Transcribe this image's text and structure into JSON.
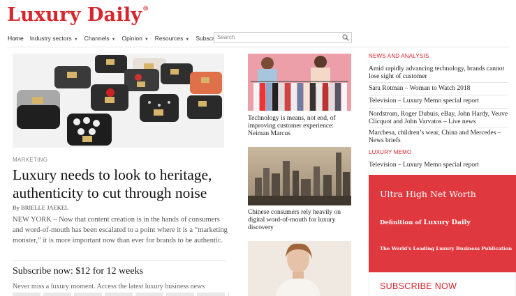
{
  "brand": {
    "name": "Luxury Daily",
    "reg": "®",
    "color": "#d6262e"
  },
  "nav": {
    "items": [
      {
        "label": "Home",
        "dropdown": false
      },
      {
        "label": "Industry sectors",
        "dropdown": true
      },
      {
        "label": "Channels",
        "dropdown": true
      },
      {
        "label": "Opinion",
        "dropdown": true
      },
      {
        "label": "Resources",
        "dropdown": true
      },
      {
        "label": "Subscribe",
        "dropdown": false
      }
    ],
    "search_placeholder": "Search"
  },
  "lead": {
    "kicker": "MARKETING",
    "headline": "Luxury needs to look to heritage, authenticity to cut through noise",
    "byline": "By BRIELLE JAEKEL",
    "teaser": "NEW YORK – Now that content creation is in the hands of consumers and word-of-mouth has been escalated to a point where it is a “marketing monster,” it is more important now than ever for brands to be authentic."
  },
  "subscribe": {
    "offer": "Subscribe now: $12 for 12 weeks",
    "desc": "Never miss a luxury moment. Access the latest luxury business news"
  },
  "middle": {
    "stories": [
      {
        "caption": "Technology is means, not end, of improving customer experience: Neiman Marcus"
      },
      {
        "caption": "Chinese consumers rely heavily on digital word-of-mouth for luxury discovery"
      }
    ]
  },
  "news": {
    "section_label": "NEWS AND ANALYSIS",
    "items": [
      "Amid rapidly advancing technology, brands cannot lose sight of customer",
      "Sara Rotman – Woman to Watch 2018",
      "Television – Luxury Memo special report",
      "Nordstrom, Roger Dubuis, eBay, John Hardy, Veuve Clicquot and John Varvatos – Live news",
      "Marchesa, children’s wear, China and Mercedes – News briefs"
    ]
  },
  "memo": {
    "section_label": "LUXURY MEMO",
    "items": [
      "Television – Luxury Memo special report"
    ]
  },
  "ad": {
    "title": "Ultra High Net Worth",
    "definition_prefix": "Definition of ",
    "definition_brand": "Luxury Daily",
    "tagline": "The World's Leading Luxury Business Publication",
    "cta": "SUBSCRIBE NOW",
    "bg": "#e0383f"
  }
}
